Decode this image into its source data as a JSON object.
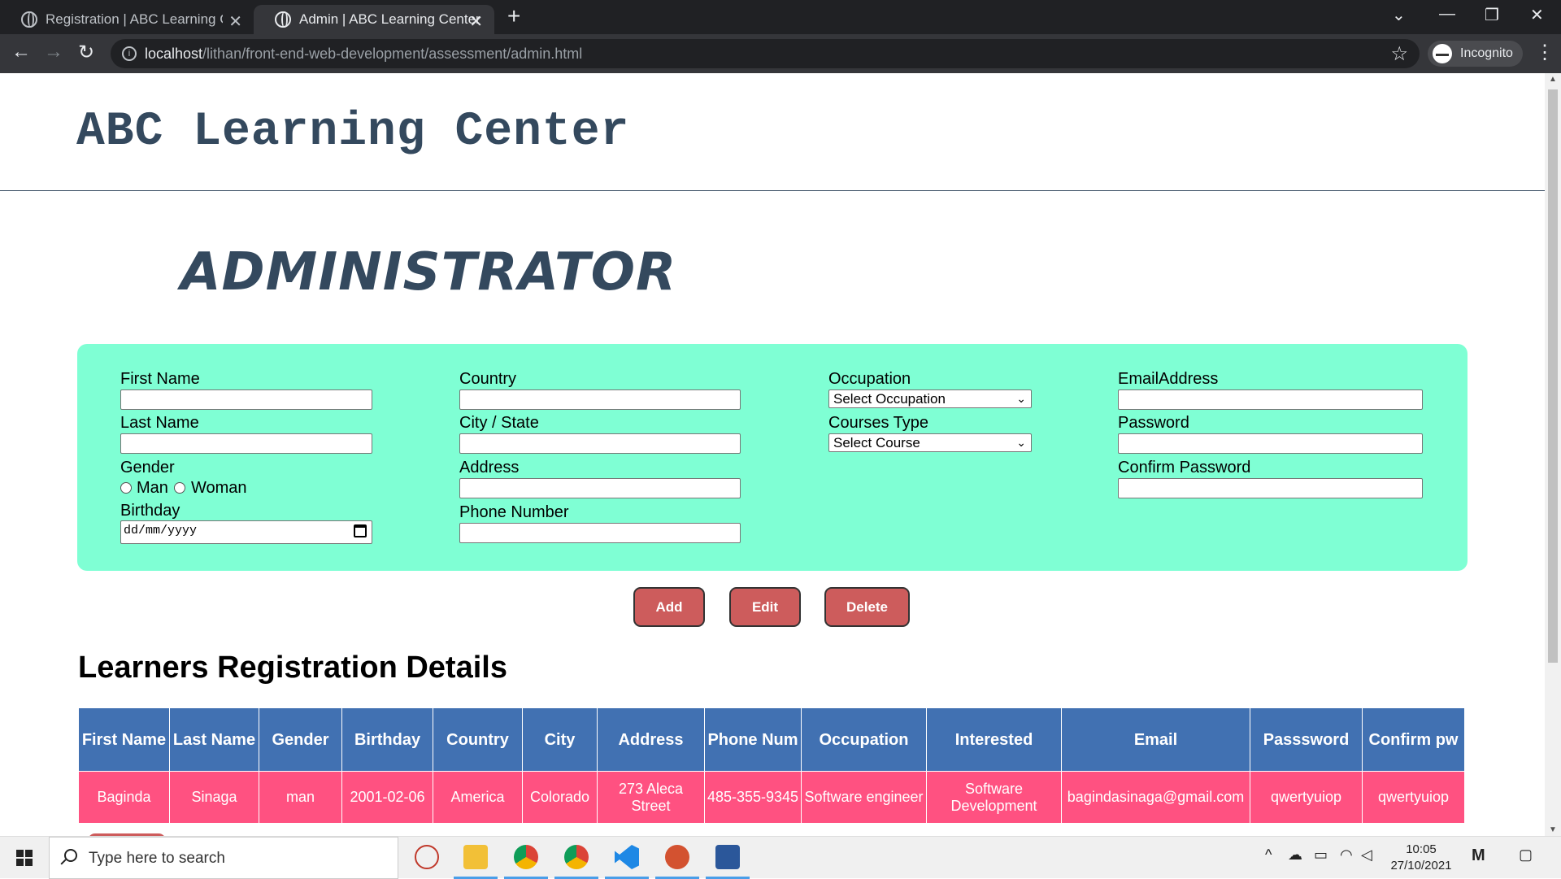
{
  "browser": {
    "tabs": [
      {
        "label": "Registration | ABC Learning Cente",
        "active": false
      },
      {
        "label": "Admin | ABC Learning Center",
        "active": true
      }
    ],
    "url_host": "localhost",
    "url_path": "/lithan/front-end-web-development/assessment/admin.html",
    "profile_label": "Incognito"
  },
  "header": {
    "brand": "ABC Learning Center"
  },
  "page_title": "ADMINISTRATOR",
  "form": {
    "first_name_label": "First Name",
    "last_name_label": "Last Name",
    "gender_label": "Gender",
    "gender_options": [
      "Man",
      "Woman"
    ],
    "birthday_label": "Birthday",
    "birthday_placeholder": "dd/mm/yyyy",
    "country_label": "Country",
    "city_label": "City / State",
    "address_label": "Address",
    "phone_label": "Phone Number",
    "occupation_label": "Occupation",
    "occupation_selected": "Select Occupation",
    "courses_label": "Courses Type",
    "courses_selected": "Select Course",
    "email_label": "EmailAddress",
    "password_label": "Password",
    "confirm_password_label": "Confirm Password"
  },
  "actions": {
    "add": "Add",
    "edit": "Edit",
    "delete": "Delete"
  },
  "table": {
    "title": "Learners Registration Details",
    "headers": [
      "First Name",
      "Last Name",
      "Gender",
      "Birthday",
      "Country",
      "City",
      "Address",
      "Phone Num",
      "Occupation",
      "Interested",
      "Email",
      "Passsword",
      "Confirm pw"
    ],
    "rows": [
      [
        "Baginda",
        "Sinaga",
        "man",
        "2001-02-06",
        "America",
        "Colorado",
        "273 Aleca Street",
        "485-355-9345",
        "Software engineer",
        "Software Development",
        "bagindasinaga@gmail.com",
        "qwertyuiop",
        "qwertyuiop"
      ]
    ]
  },
  "taskbar": {
    "search_placeholder": "Type here to search",
    "time": "10:05",
    "date": "27/10/2021"
  },
  "colors": {
    "form_bg": "#7fffd4",
    "heading": "#34495e",
    "button": "#cd5c5c",
    "table_header": "#4171b2",
    "table_row": "#ff5181"
  }
}
